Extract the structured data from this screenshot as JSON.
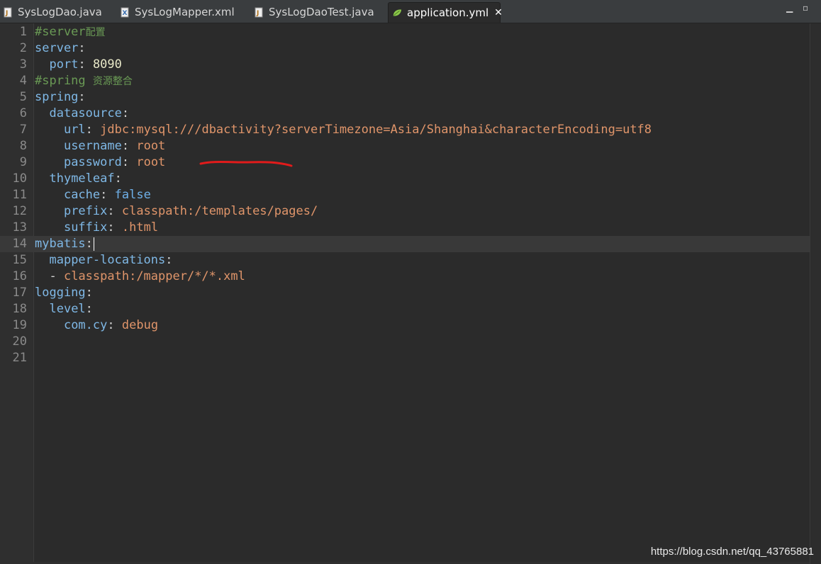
{
  "tabs": [
    {
      "label": "SysLogDao.java",
      "icon": "java-file-icon",
      "active": false
    },
    {
      "label": "SysLogMapper.xml",
      "icon": "xml-file-icon",
      "active": false
    },
    {
      "label": "SysLogDaoTest.java",
      "icon": "java-file-icon",
      "active": false
    },
    {
      "label": "application.yml",
      "icon": "spring-leaf-icon",
      "active": true
    }
  ],
  "window_controls": {
    "minimize": "▁",
    "maximize": "▫"
  },
  "tab_close_glyph": "✕",
  "editor": {
    "lines": [
      {
        "num": "1",
        "c_hash": "#server",
        "c_cn": "配置"
      },
      {
        "num": "2",
        "key": "server",
        "colon": ":"
      },
      {
        "num": "3",
        "indent": "  ",
        "key": "port",
        "colon": ":",
        "sp": " ",
        "num_val": "8090"
      },
      {
        "num": "4",
        "c_hash": "#spring ",
        "c_cn": "资源整合"
      },
      {
        "num": "5",
        "key": "spring",
        "colon": ":"
      },
      {
        "num": "6",
        "indent": "  ",
        "key": "datasource",
        "colon": ":"
      },
      {
        "num": "7",
        "indent": "    ",
        "key": "url",
        "colon": ":",
        "sp": " ",
        "str_val": "jdbc:mysql:///dbactivity?serverTimezone=Asia/Shanghai&characterEncoding=utf8"
      },
      {
        "num": "8",
        "indent": "    ",
        "key": "username",
        "colon": ":",
        "sp": " ",
        "str_val": "root"
      },
      {
        "num": "9",
        "indent": "    ",
        "key": "password",
        "colon": ":",
        "sp": " ",
        "str_val": "root"
      },
      {
        "num": "10",
        "indent": "  ",
        "key": "thymeleaf",
        "colon": ":"
      },
      {
        "num": "11",
        "indent": "    ",
        "key": "cache",
        "colon": ":",
        "sp": " ",
        "bool_val": "false"
      },
      {
        "num": "12",
        "indent": "    ",
        "key": "prefix",
        "colon": ":",
        "sp": " ",
        "str_val": "classpath:/templates/pages/"
      },
      {
        "num": "13",
        "indent": "    ",
        "key": "suffix",
        "colon": ":",
        "sp": " ",
        "str_val": ".html"
      },
      {
        "num": "14",
        "key": "mybatis",
        "colon": ":",
        "current": true
      },
      {
        "num": "15",
        "indent": "  ",
        "key": "mapper-locations",
        "colon": ":"
      },
      {
        "num": "16",
        "indent": "  ",
        "dash": "- ",
        "str_val": "classpath:/mapper/*/*.xml"
      },
      {
        "num": "17",
        "key": "logging",
        "colon": ":"
      },
      {
        "num": "18",
        "indent": "  ",
        "key": "level",
        "colon": ":"
      },
      {
        "num": "19",
        "indent": "    ",
        "key": "com.cy",
        "colon": ":",
        "sp": " ",
        "str_val": "debug"
      },
      {
        "num": "20"
      },
      {
        "num": "21"
      }
    ]
  },
  "colors": {
    "key": "#7fb8e6",
    "string": "#e0956a",
    "comment": "#6a9a55",
    "annotation": "#e11b1b"
  },
  "watermark": "https://blog.csdn.net/qq_43765881"
}
